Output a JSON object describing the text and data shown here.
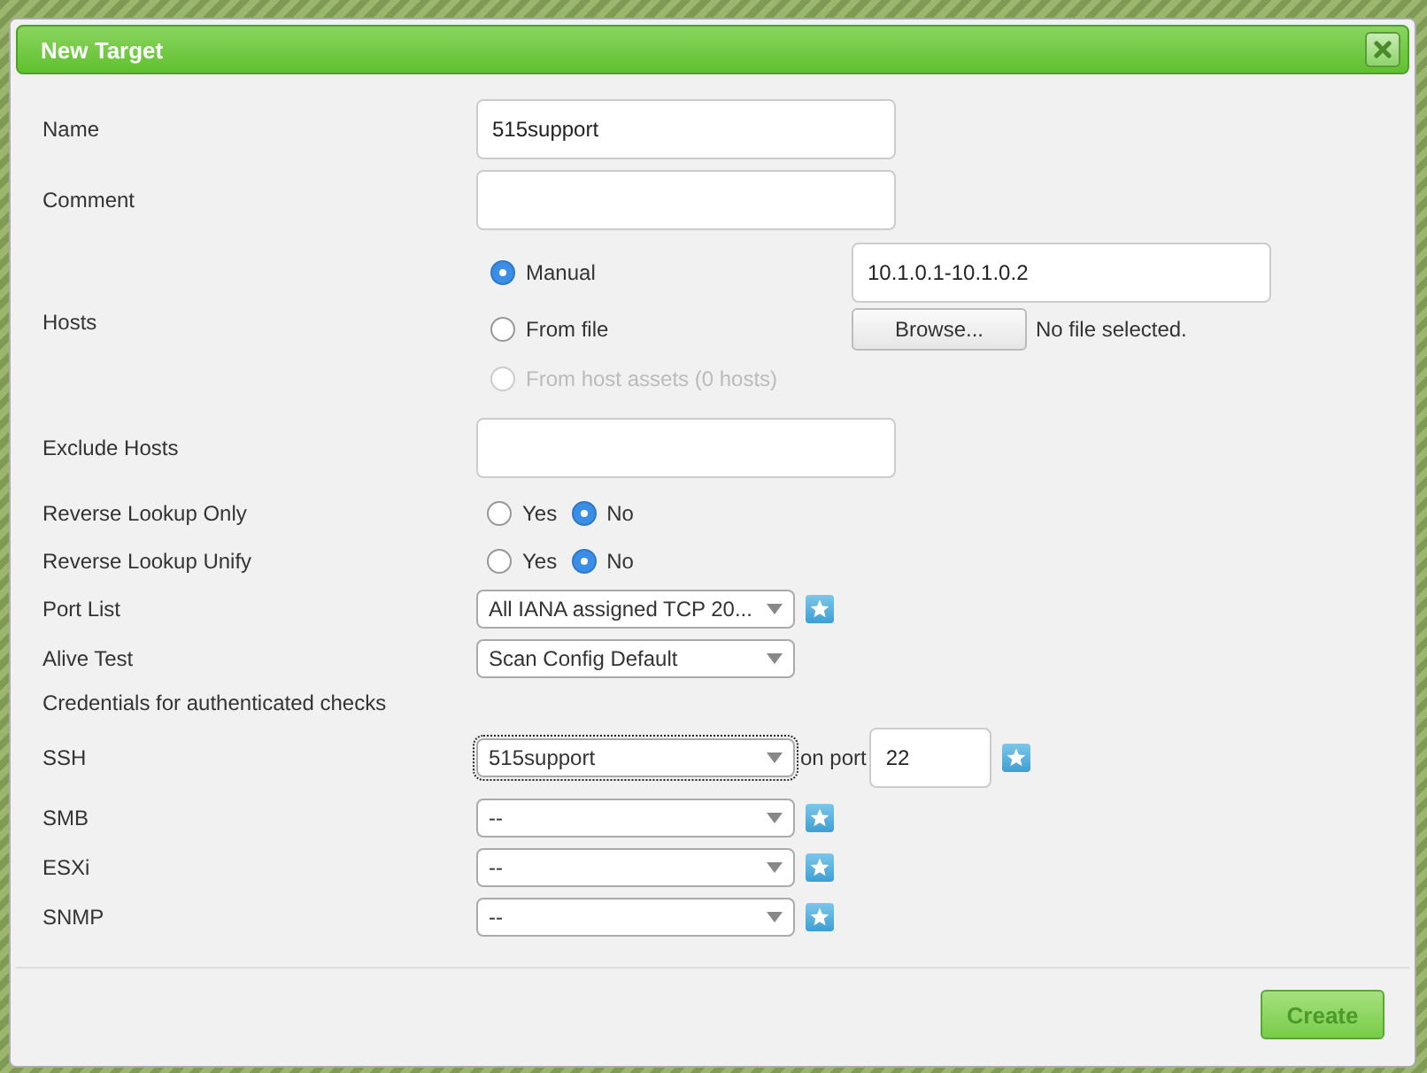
{
  "dialog": {
    "title": "New Target"
  },
  "rows": [
    {
      "kind": "text",
      "label": "Name",
      "value": "515support"
    },
    {
      "kind": "text",
      "label": "Comment"
    },
    {
      "kind": "hosts",
      "label": "Hosts",
      "options": [
        {
          "label": "Manual",
          "selected": true,
          "disabled": false
        },
        {
          "label": "From file",
          "selected": false,
          "disabled": false
        },
        {
          "label": "From host assets (0 hosts)",
          "selected": false,
          "disabled": true
        }
      ],
      "manual_value": "10.1.0.1-10.1.0.2",
      "browse_button": "Browse...",
      "file_status": "No file selected."
    },
    {
      "kind": "text",
      "label": "Exclude Hosts"
    },
    {
      "kind": "yesno",
      "label": "Reverse Lookup Only",
      "options": [
        {
          "label": "Yes",
          "selected": false
        },
        {
          "label": "No",
          "selected": true
        }
      ]
    },
    {
      "kind": "yesno",
      "label": "Reverse Lookup Unify",
      "options": [
        {
          "label": "Yes",
          "selected": false
        },
        {
          "label": "No",
          "selected": true
        }
      ]
    },
    {
      "kind": "select",
      "label": "Port List",
      "value": "All IANA assigned TCP 20...",
      "new_button": true
    },
    {
      "kind": "select",
      "label": "Alive Test",
      "value": "Scan Config Default"
    },
    {
      "kind": "heading",
      "label": "Credentials for authenticated checks"
    },
    {
      "kind": "select",
      "label": "SSH",
      "value": "515support",
      "focused": true,
      "port_label": "on port",
      "port": "22",
      "new_button": true
    },
    {
      "kind": "select",
      "label": "SMB",
      "value": "--",
      "new_button": true
    },
    {
      "kind": "select",
      "label": "ESXi",
      "value": "--",
      "new_button": true
    },
    {
      "kind": "select",
      "label": "SNMP",
      "value": "--",
      "new_button": true
    }
  ],
  "footer": {
    "create_button": "Create"
  }
}
